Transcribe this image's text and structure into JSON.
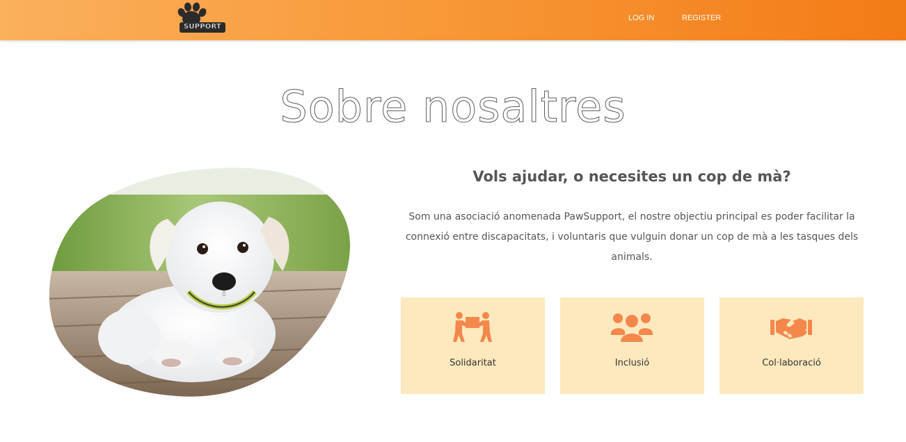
{
  "header": {
    "logo_text": "SUPPORT",
    "nav": {
      "login": "LOG IN",
      "register": "REGISTER"
    },
    "gradient_colors": [
      "#fbb05c",
      "#f37b16"
    ]
  },
  "page": {
    "title": "Sobre nosaltres"
  },
  "about": {
    "image_icon": "puppy-photo",
    "subtitle": "Vols ajudar, o necesites un cop de mà?",
    "description": "Som una asociació anomenada PawSupport, el nostre objectiu principal es poder facilitar la connexió entre discapacitats, i voluntaris que vulguin donar un cop de mà a les tasques dels animals."
  },
  "features": [
    {
      "label": "Solidaritat",
      "icon": "people-carrying-box-icon"
    },
    {
      "label": "Inclusió",
      "icon": "group-users-icon"
    },
    {
      "label": "Col·laboració",
      "icon": "handshake-icon"
    }
  ],
  "colors": {
    "accent": "#f58a2e",
    "card_background": "#fde9bd",
    "icon_color": "#f4874b"
  }
}
